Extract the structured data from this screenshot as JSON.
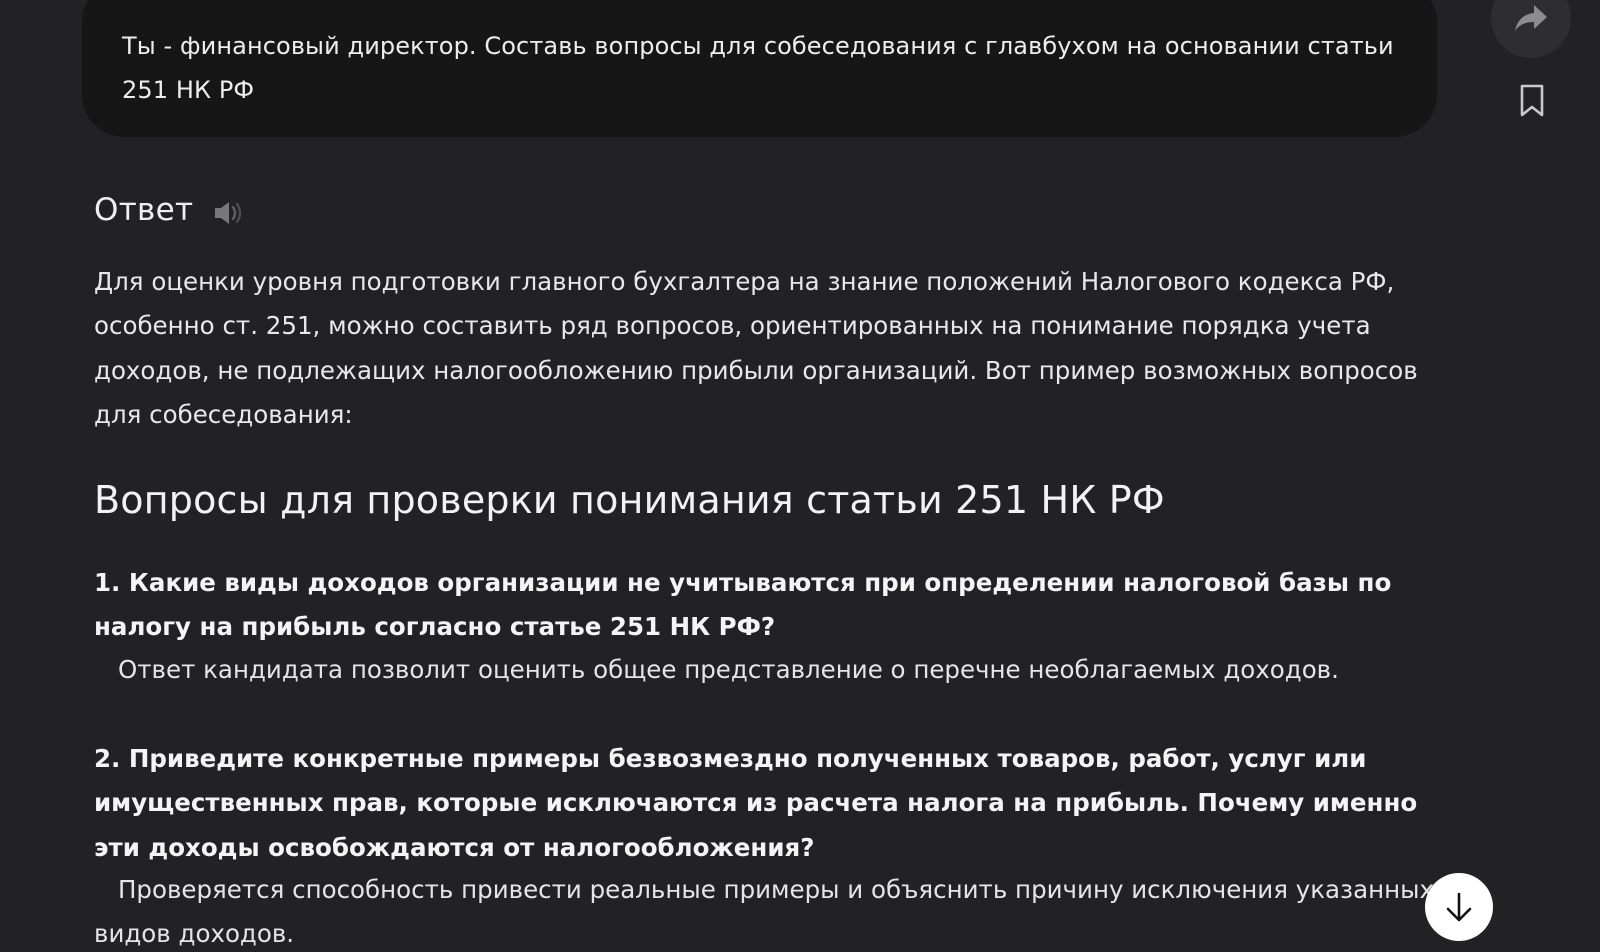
{
  "user_message": {
    "text": "Ты - финансовый директор. Составь вопросы для собеседования с главбухом на основании статьи 251 НК РФ"
  },
  "answer": {
    "title": "Ответ",
    "intro": "Для оценки уровня подготовки главного бухгалтера на знание положений Налогового кодекса РФ, особенно ст. 251, можно составить ряд вопросов, ориентированных на понимание порядка учета доходов, не подлежащих налогообложению прибыли организаций. Вот пример возможных вопросов для собеседования:",
    "heading": "Вопросы для проверки понимания статьи 251 НК РФ",
    "questions": [
      {
        "question": "1. Какие виды доходов организации не учитываются при определении налоговой базы по налогу на прибыль согласно статье 251 НК РФ?",
        "note": "Ответ кандидата позволит оценить общее представление о перечне необлагаемых доходов."
      },
      {
        "question": "2. Приведите конкретные примеры безвозмездно полученных товаров, работ, услуг или имущественных прав, которые исключаются из расчета налога на прибыль. Почему именно эти доходы освобождаются от налогообложения?",
        "note": "Проверяется способность привести реальные примеры и объяснить причину исключения указанных видов доходов."
      }
    ]
  },
  "icons": {
    "share": "share-arrow-icon",
    "bookmark": "bookmark-icon",
    "speaker": "speaker-icon",
    "scroll_down": "arrow-down-icon"
  },
  "colors": {
    "background": "#222225",
    "user_bubble": "#161617",
    "text": "#e9e9ea",
    "scroll_button": "#ffffff"
  }
}
